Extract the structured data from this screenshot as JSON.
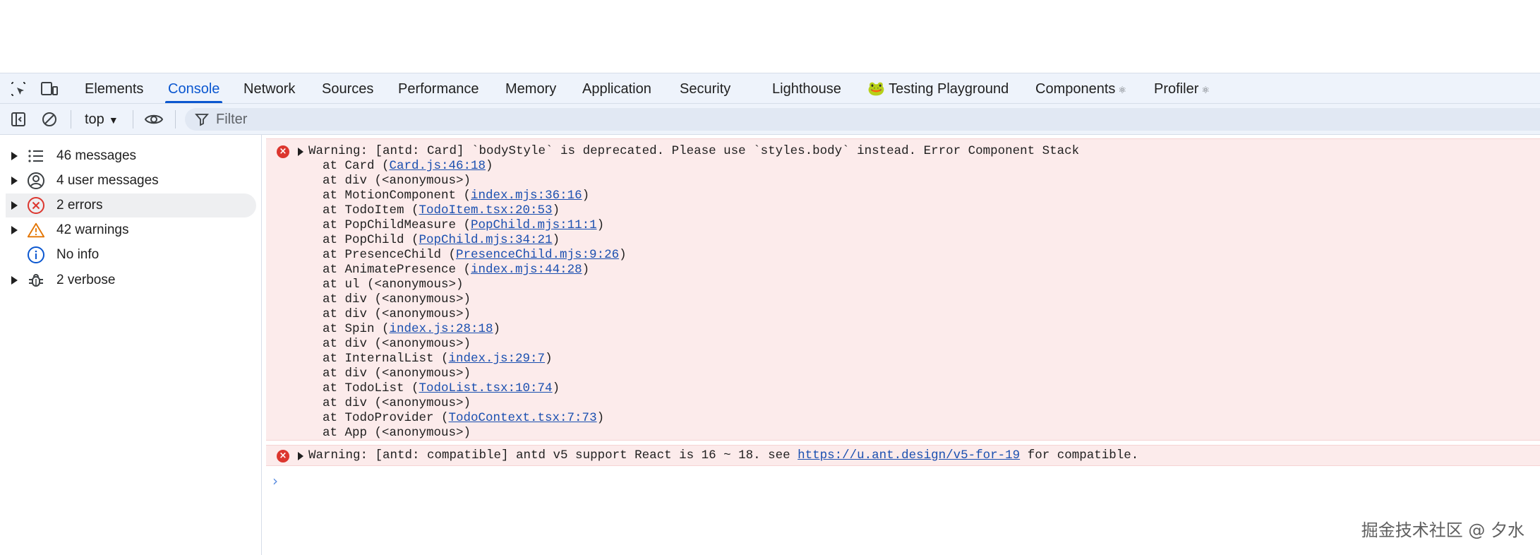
{
  "tabs": [
    {
      "label": "Elements",
      "active": false
    },
    {
      "label": "Console",
      "active": true
    },
    {
      "label": "Network",
      "active": false
    },
    {
      "label": "Sources",
      "active": false
    },
    {
      "label": "Performance",
      "active": false
    },
    {
      "label": "Memory",
      "active": false
    },
    {
      "label": "Application",
      "active": false
    },
    {
      "label": "Security",
      "active": false
    },
    {
      "label": "Lighthouse",
      "active": false
    },
    {
      "label": "🐸 Testing Playground",
      "active": false
    },
    {
      "label": "Components",
      "active": false,
      "gear": "⚛"
    },
    {
      "label": "Profiler",
      "active": false,
      "gear": "⚛"
    }
  ],
  "toolbar": {
    "context": "top",
    "filter_placeholder": "Filter"
  },
  "sidebar": {
    "items": [
      {
        "label": "46 messages",
        "icon": "list-icon",
        "expandable": true
      },
      {
        "label": "4 user messages",
        "icon": "user-circle-icon",
        "expandable": true
      },
      {
        "label": "2 errors",
        "icon": "error-circle-icon",
        "expandable": true,
        "selected": true
      },
      {
        "label": "42 warnings",
        "icon": "warning-triangle-icon",
        "expandable": true
      },
      {
        "label": "No info",
        "icon": "info-icon",
        "expandable": false
      },
      {
        "label": "2 verbose",
        "icon": "bug-icon",
        "expandable": true
      }
    ]
  },
  "console": {
    "message1": {
      "text": "Warning: [antd: Card] `bodyStyle` is deprecated. Please use `styles.body` instead. Error Component Stack",
      "stack": [
        {
          "pre": "at Card (",
          "link": "Card.js:46:18",
          "post": ")"
        },
        {
          "pre": "at div (<anonymous>)",
          "link": "",
          "post": ""
        },
        {
          "pre": "at MotionComponent (",
          "link": "index.mjs:36:16",
          "post": ")"
        },
        {
          "pre": "at TodoItem (",
          "link": "TodoItem.tsx:20:53",
          "post": ")"
        },
        {
          "pre": "at PopChildMeasure (",
          "link": "PopChild.mjs:11:1",
          "post": ")"
        },
        {
          "pre": "at PopChild (",
          "link": "PopChild.mjs:34:21",
          "post": ")"
        },
        {
          "pre": "at PresenceChild (",
          "link": "PresenceChild.mjs:9:26",
          "post": ")"
        },
        {
          "pre": "at AnimatePresence (",
          "link": "index.mjs:44:28",
          "post": ")"
        },
        {
          "pre": "at ul (<anonymous>)",
          "link": "",
          "post": ""
        },
        {
          "pre": "at div (<anonymous>)",
          "link": "",
          "post": ""
        },
        {
          "pre": "at div (<anonymous>)",
          "link": "",
          "post": ""
        },
        {
          "pre": "at Spin (",
          "link": "index.js:28:18",
          "post": ")"
        },
        {
          "pre": "at div (<anonymous>)",
          "link": "",
          "post": ""
        },
        {
          "pre": "at InternalList (",
          "link": "index.js:29:7",
          "post": ")"
        },
        {
          "pre": "at div (<anonymous>)",
          "link": "",
          "post": ""
        },
        {
          "pre": "at TodoList (",
          "link": "TodoList.tsx:10:74",
          "post": ")"
        },
        {
          "pre": "at div (<anonymous>)",
          "link": "",
          "post": ""
        },
        {
          "pre": "at TodoProvider (",
          "link": "TodoContext.tsx:7:73",
          "post": ")"
        },
        {
          "pre": "at App (<anonymous>)",
          "link": "",
          "post": ""
        }
      ]
    },
    "message2": {
      "pre": "Warning: [antd: compatible] antd v5 support React is 16 ~ 18. see ",
      "link": "https://u.ant.design/v5-for-19",
      "post": " for compatible."
    },
    "prompt": "›"
  },
  "watermark": "掘金技术社区 @ 夕水",
  "colors": {
    "accent": "#0b57d0",
    "error": "#dc362e",
    "error_bg": "#fcebeb",
    "link": "#1a4fb0"
  }
}
